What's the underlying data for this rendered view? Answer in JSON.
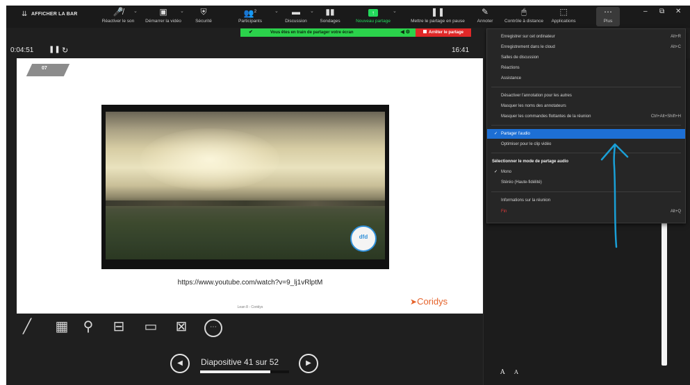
{
  "toolbar": {
    "afficher_label": "AFFICHER LA BAR",
    "items": [
      {
        "icon": "microphone-muted-icon",
        "label": "Réactiver le son"
      },
      {
        "icon": "video-off-icon",
        "label": "Démarrer la vidéo"
      },
      {
        "icon": "shield-icon",
        "label": "Sécurité"
      },
      {
        "icon": "participants-icon",
        "label": "Participants",
        "count": "2"
      },
      {
        "icon": "chat-icon",
        "label": "Discussion"
      },
      {
        "icon": "polls-icon",
        "label": "Sondages"
      },
      {
        "icon": "new-share-icon",
        "label": "Nouveau partage"
      },
      {
        "icon": "pause-icon",
        "label": "Mettre le partage en pause"
      },
      {
        "icon": "annotate-icon",
        "label": "Annoter"
      },
      {
        "icon": "remote-control-icon",
        "label": "Contrôle à distance"
      },
      {
        "icon": "apps-icon",
        "label": "Applications"
      },
      {
        "icon": "more-icon",
        "label": "Plus"
      }
    ],
    "accent_green": "#23d95c"
  },
  "share_banner": {
    "text": "Vous êtes en train de partager votre écran",
    "stop_label": "Arrêter le partage",
    "banner_color": "#2bd24b",
    "stop_color": "#e02828"
  },
  "presenter": {
    "elapsed": "0:04:51",
    "clock": "16:41",
    "slide_tag": "07",
    "video_url": "https://www.youtube.com/watch?v=9_lj1vRlptM",
    "footer": "Lean 8 - Coridys",
    "brand": "Coridys",
    "video_logo": "dfd",
    "counter": "Diapositive 41 sur 52",
    "progress": 0.79
  },
  "tools": [
    {
      "name": "pen-tool-icon"
    },
    {
      "name": "slide-sorter-icon"
    },
    {
      "name": "zoom-icon"
    },
    {
      "name": "display-settings-icon"
    },
    {
      "name": "subtitles-icon"
    },
    {
      "name": "camera-off-icon"
    },
    {
      "name": "more-options-icon"
    }
  ],
  "menu": {
    "items": [
      {
        "label": "Enregistrer sur cet ordinateur",
        "shortcut": "Alt+R"
      },
      {
        "label": "Enregistrement dans le cloud",
        "shortcut": "Alt+C"
      },
      {
        "label": "Salles de discussion",
        "shortcut": ""
      },
      {
        "label": "Réactions",
        "shortcut": ""
      },
      {
        "label": "Assistance",
        "shortcut": ""
      },
      {
        "label": "Désactiver l'annotation pour les autres",
        "shortcut": ""
      },
      {
        "label": "Masquer les noms des annotateurs",
        "shortcut": ""
      },
      {
        "label": "Masquer les commandes flottantes de la réunion",
        "shortcut": "Ctrl+Alt+Shift+H"
      },
      {
        "label": "Partager l'audio",
        "shortcut": "",
        "checked": true,
        "highlighted": true
      },
      {
        "label": "Optimiser pour le clip vidéo",
        "shortcut": ""
      },
      {
        "label": "Sélectionner le mode de partage audio",
        "shortcut": "",
        "header": true
      },
      {
        "label": "Mono",
        "shortcut": "",
        "checked": true
      },
      {
        "label": "Stéréo (Haute-fidélité)",
        "shortcut": ""
      },
      {
        "label": "Informations sur la réunion",
        "shortcut": ""
      },
      {
        "label": "Fin",
        "shortcut": "Alt+Q",
        "danger": true
      }
    ],
    "highlight_color": "#1d6fd4"
  },
  "panel": {
    "font_increase": "A",
    "font_decrease": "A"
  },
  "annotation": {
    "arrow_color": "#1a9fd6"
  }
}
